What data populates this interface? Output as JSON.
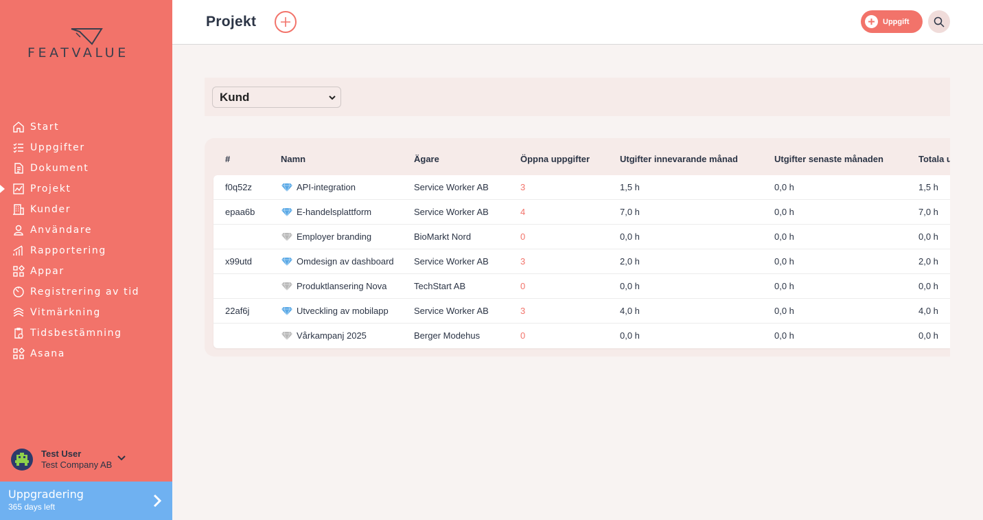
{
  "brand": {
    "logo_text": "FEATVALUE"
  },
  "sidebar": {
    "items": [
      {
        "label": "Start",
        "icon": "home-icon"
      },
      {
        "label": "Uppgifter",
        "icon": "checklist-icon"
      },
      {
        "label": "Dokument",
        "icon": "document-icon"
      },
      {
        "label": "Projekt",
        "icon": "chart-icon",
        "active": true
      },
      {
        "label": "Kunder",
        "icon": "building-icon"
      },
      {
        "label": "Användare",
        "icon": "user-icon"
      },
      {
        "label": "Rapportering",
        "icon": "bar-chart-icon"
      },
      {
        "label": "Appar",
        "icon": "grid-icon"
      },
      {
        "label": "Registrering av tid",
        "icon": "timer-icon"
      },
      {
        "label": "Vitmärkning",
        "icon": "badge-icon"
      },
      {
        "label": "Tidsbestämning",
        "icon": "clipboard-clock-icon"
      },
      {
        "label": "Asana",
        "icon": "grid-icon"
      }
    ]
  },
  "user": {
    "name": "Test User",
    "company": "Test Company AB"
  },
  "upgrade": {
    "title": "Uppgradering",
    "subtitle": "365 days left"
  },
  "header": {
    "title": "Projekt",
    "task_button": "Uppgift"
  },
  "filter": {
    "selected": "Kund"
  },
  "table": {
    "columns": [
      "#",
      "Namn",
      "Ägare",
      "Öppna uppgifter",
      "Utgifter innevarande månad",
      "Utgifter senaste månaden",
      "Totala utgifter"
    ],
    "rows": [
      {
        "id": "f0q52z",
        "name": "API-integration",
        "gem": "blue",
        "owner": "Service Worker AB",
        "open": "3",
        "current": "1,5 h",
        "last": "0,0 h",
        "total": "1,5 h"
      },
      {
        "id": "epaa6b",
        "name": "E-handelsplattform",
        "gem": "blue",
        "owner": "Service Worker AB",
        "open": "4",
        "current": "7,0 h",
        "last": "0,0 h",
        "total": "7,0 h"
      },
      {
        "id": "",
        "name": "Employer branding",
        "gem": "gray",
        "owner": "BioMarkt Nord",
        "open": "0",
        "current": "0,0 h",
        "last": "0,0 h",
        "total": "0,0 h"
      },
      {
        "id": "x99utd",
        "name": "Omdesign av dashboard",
        "gem": "blue",
        "owner": "Service Worker AB",
        "open": "3",
        "current": "2,0 h",
        "last": "0,0 h",
        "total": "2,0 h"
      },
      {
        "id": "",
        "name": "Produktlansering Nova",
        "gem": "gray",
        "owner": "TechStart AB",
        "open": "0",
        "current": "0,0 h",
        "last": "0,0 h",
        "total": "0,0 h"
      },
      {
        "id": "22af6j",
        "name": "Utveckling av mobilapp",
        "gem": "blue",
        "owner": "Service Worker AB",
        "open": "3",
        "current": "4,0 h",
        "last": "0,0 h",
        "total": "4,0 h"
      },
      {
        "id": "",
        "name": "Vårkampanj 2025",
        "gem": "gray",
        "owner": "Berger Modehus",
        "open": "0",
        "current": "0,0 h",
        "last": "0,0 h",
        "total": "0,0 h"
      }
    ]
  },
  "colors": {
    "accent": "#f2736a",
    "upgrade": "#6fb1f1",
    "text": "#2b3445",
    "gem_blue": "#5aa9e6",
    "gem_gray": "#b8b8b8"
  }
}
